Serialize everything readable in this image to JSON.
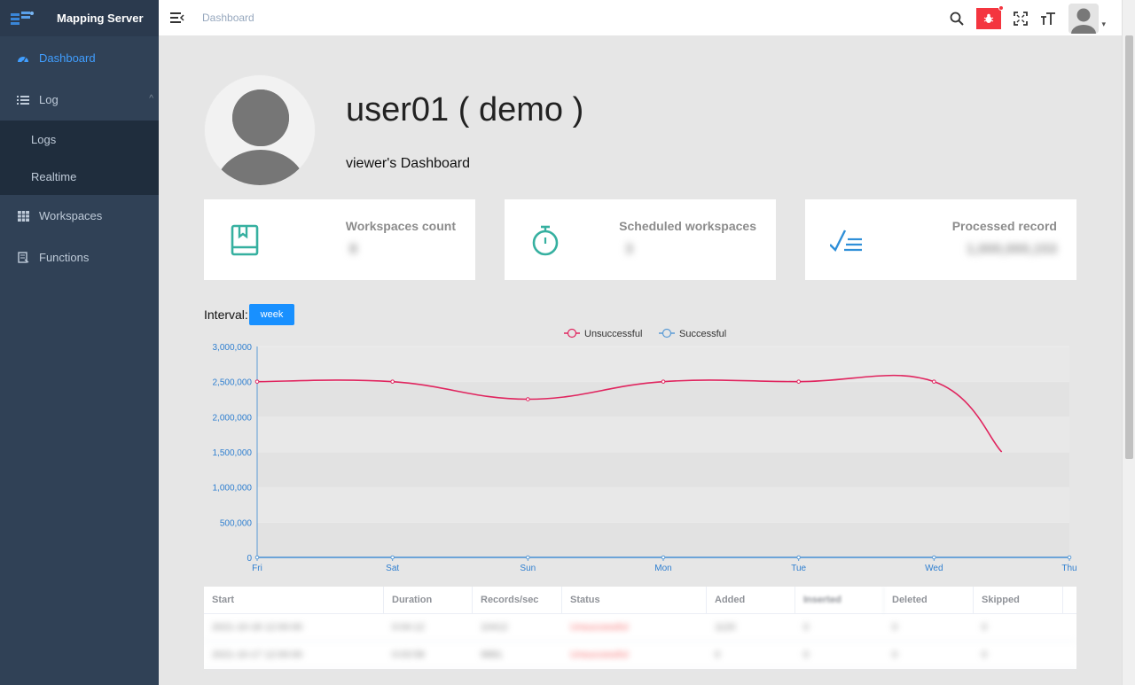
{
  "app": {
    "title": "Mapping Server"
  },
  "sidebar": {
    "items": [
      {
        "label": "Dashboard",
        "icon": "dashboard-icon"
      },
      {
        "label": "Log",
        "icon": "list-icon",
        "children": [
          {
            "label": "Logs"
          },
          {
            "label": "Realtime"
          }
        ]
      },
      {
        "label": "Workspaces",
        "icon": "grid-icon"
      },
      {
        "label": "Functions",
        "icon": "document-icon"
      }
    ]
  },
  "header": {
    "breadcrumb": "Dashboard",
    "icons": [
      "search-icon",
      "bug-icon",
      "fullscreen-icon",
      "font-size-icon",
      "avatar"
    ]
  },
  "profile": {
    "name": "user01 ( demo )",
    "role": "viewer's Dashboard"
  },
  "cards": [
    {
      "label": "Workspaces count",
      "value": "8",
      "icon": "book-icon"
    },
    {
      "label": "Scheduled workspaces",
      "value": "3",
      "icon": "stopwatch-icon"
    },
    {
      "label": "Processed record",
      "value": "1,000,000,153",
      "icon": "checklist-icon"
    }
  ],
  "interval": {
    "label": "Interval:",
    "button": "week"
  },
  "chart_data": {
    "type": "line",
    "categories": [
      "Fri",
      "Sat",
      "Sun",
      "Mon",
      "Tue",
      "Wed",
      "Thu"
    ],
    "series": [
      {
        "name": "Unsuccessful",
        "color": "#e0245e",
        "values": [
          2500000,
          2500000,
          2250000,
          2500000,
          2500000,
          2500000,
          1500000
        ]
      },
      {
        "name": "Successful",
        "color": "#5b9bd5",
        "values": [
          0,
          0,
          0,
          0,
          0,
          0,
          0
        ]
      }
    ],
    "ylim": [
      0,
      3000000
    ],
    "yticks": [
      "0",
      "500,000",
      "1,000,000",
      "1,500,000",
      "2,000,000",
      "2,500,000",
      "3,000,000"
    ],
    "legend": "top-center",
    "grid": true
  },
  "table": {
    "columns": [
      "Start",
      "Duration",
      "Records/sec",
      "Status",
      "Added",
      "Inserted",
      "Deleted",
      "Skipped"
    ],
    "rows": [
      [
        "2021-10-18 12:00:00",
        "0:04:12",
        "10412",
        "Unsuccessful",
        "1120",
        "0",
        "0",
        "0"
      ],
      [
        "2021-10-17 12:00:00",
        "0:03:58",
        "9881",
        "Unsuccessful",
        "0",
        "0",
        "0",
        "0"
      ]
    ]
  }
}
